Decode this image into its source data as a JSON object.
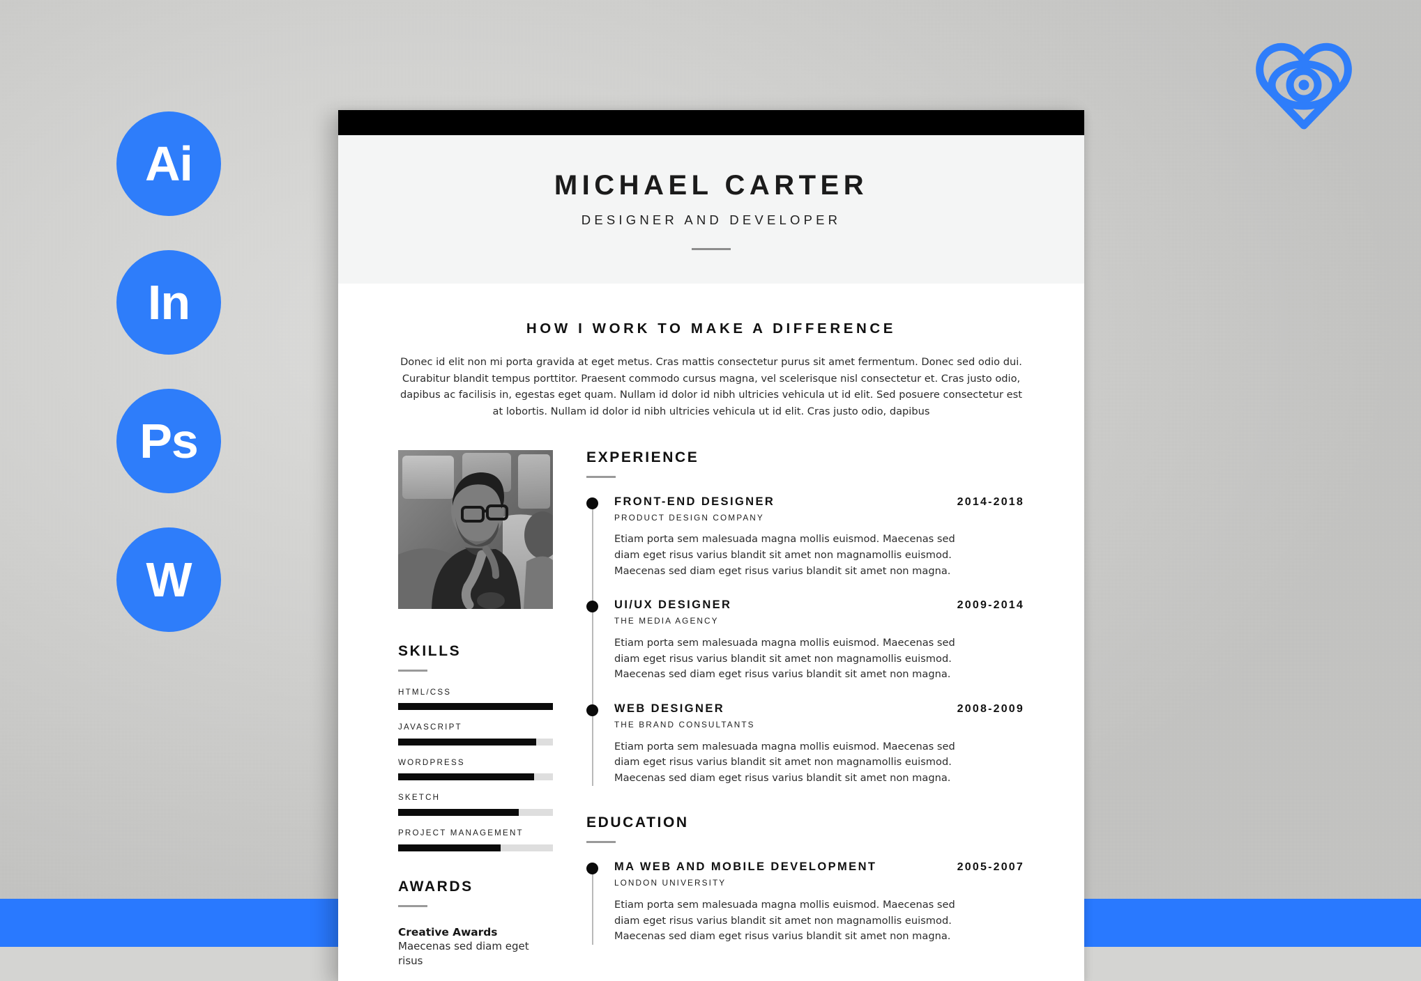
{
  "mockup": {
    "background_color": "#d2d2d0",
    "accent_color": "#2979ff",
    "bottom_band_color": "#2979ff"
  },
  "app_icons": [
    {
      "name": "illustrator",
      "label": "Ai"
    },
    {
      "name": "indesign",
      "label": "In"
    },
    {
      "name": "photoshop",
      "label": "Ps"
    },
    {
      "name": "word",
      "label": "W"
    }
  ],
  "logo": {
    "icon": "heart-eye-icon",
    "color": "#2e7dfa"
  },
  "resume": {
    "header": {
      "name": "MICHAEL CARTER",
      "title": "DESIGNER AND DEVELOPER"
    },
    "intro": {
      "heading": "HOW I WORK TO MAKE A DIFFERENCE",
      "text": "Donec id elit non mi porta gravida at eget metus. Cras mattis consectetur purus sit amet fermentum. Donec sed odio dui. Curabitur blandit tempus porttitor. Praesent commodo cursus magna, vel scelerisque nisl consectetur et. Cras justo odio, dapibus ac facilisis in, egestas eget quam. Nullam id dolor id nibh ultricies vehicula ut id elit. Sed posuere consectetur est at lobortis. Nullam id dolor id nibh ultricies vehicula ut id elit. Cras justo odio, dapibus"
    },
    "photo": {
      "alt": "portrait-photo"
    },
    "skills": {
      "title": "SKILLS",
      "items": [
        {
          "label": "HTML/CSS",
          "value": 100
        },
        {
          "label": "JAVASCRIPT",
          "value": 89
        },
        {
          "label": "WORDPRESS",
          "value": 88
        },
        {
          "label": "SKETCH",
          "value": 78
        },
        {
          "label": "PROJECT MANAGEMENT",
          "value": 66
        }
      ]
    },
    "awards": {
      "title": "AWARDS",
      "items": [
        {
          "name": "Creative Awards",
          "desc": "Maecenas sed diam eget risus"
        }
      ]
    },
    "experience": {
      "title": "EXPERIENCE",
      "items": [
        {
          "role": "FRONT-END DESIGNER",
          "company": "PRODUCT DESIGN COMPANY",
          "years": "2014-2018",
          "desc": "Etiam porta sem malesuada magna mollis euismod. Maecenas sed diam eget risus varius blandit sit amet non magnamollis euismod. Maecenas sed diam eget risus varius blandit sit amet non magna."
        },
        {
          "role": "UI/UX DESIGNER",
          "company": "THE MEDIA AGENCY",
          "years": "2009-2014",
          "desc": "Etiam porta sem malesuada magna mollis euismod. Maecenas sed diam eget risus varius blandit sit amet non magnamollis euismod. Maecenas sed diam eget risus varius blandit sit amet non magna."
        },
        {
          "role": "WEB DESIGNER",
          "company": "THE BRAND CONSULTANTS",
          "years": "2008-2009",
          "desc": "Etiam porta sem malesuada magna mollis euismod. Maecenas sed diam eget risus varius blandit sit amet non magnamollis euismod. Maecenas sed diam eget risus varius blandit sit amet non magna."
        }
      ]
    },
    "education": {
      "title": "EDUCATION",
      "items": [
        {
          "role": "MA WEB AND MOBILE DEVELOPMENT",
          "company": "LONDON UNIVERSITY",
          "years": "2005-2007",
          "desc": "Etiam porta sem malesuada magna mollis euismod. Maecenas sed diam eget risus varius blandit sit amet non magnamollis euismod. Maecenas sed diam eget risus varius blandit sit amet non magna."
        }
      ]
    }
  }
}
